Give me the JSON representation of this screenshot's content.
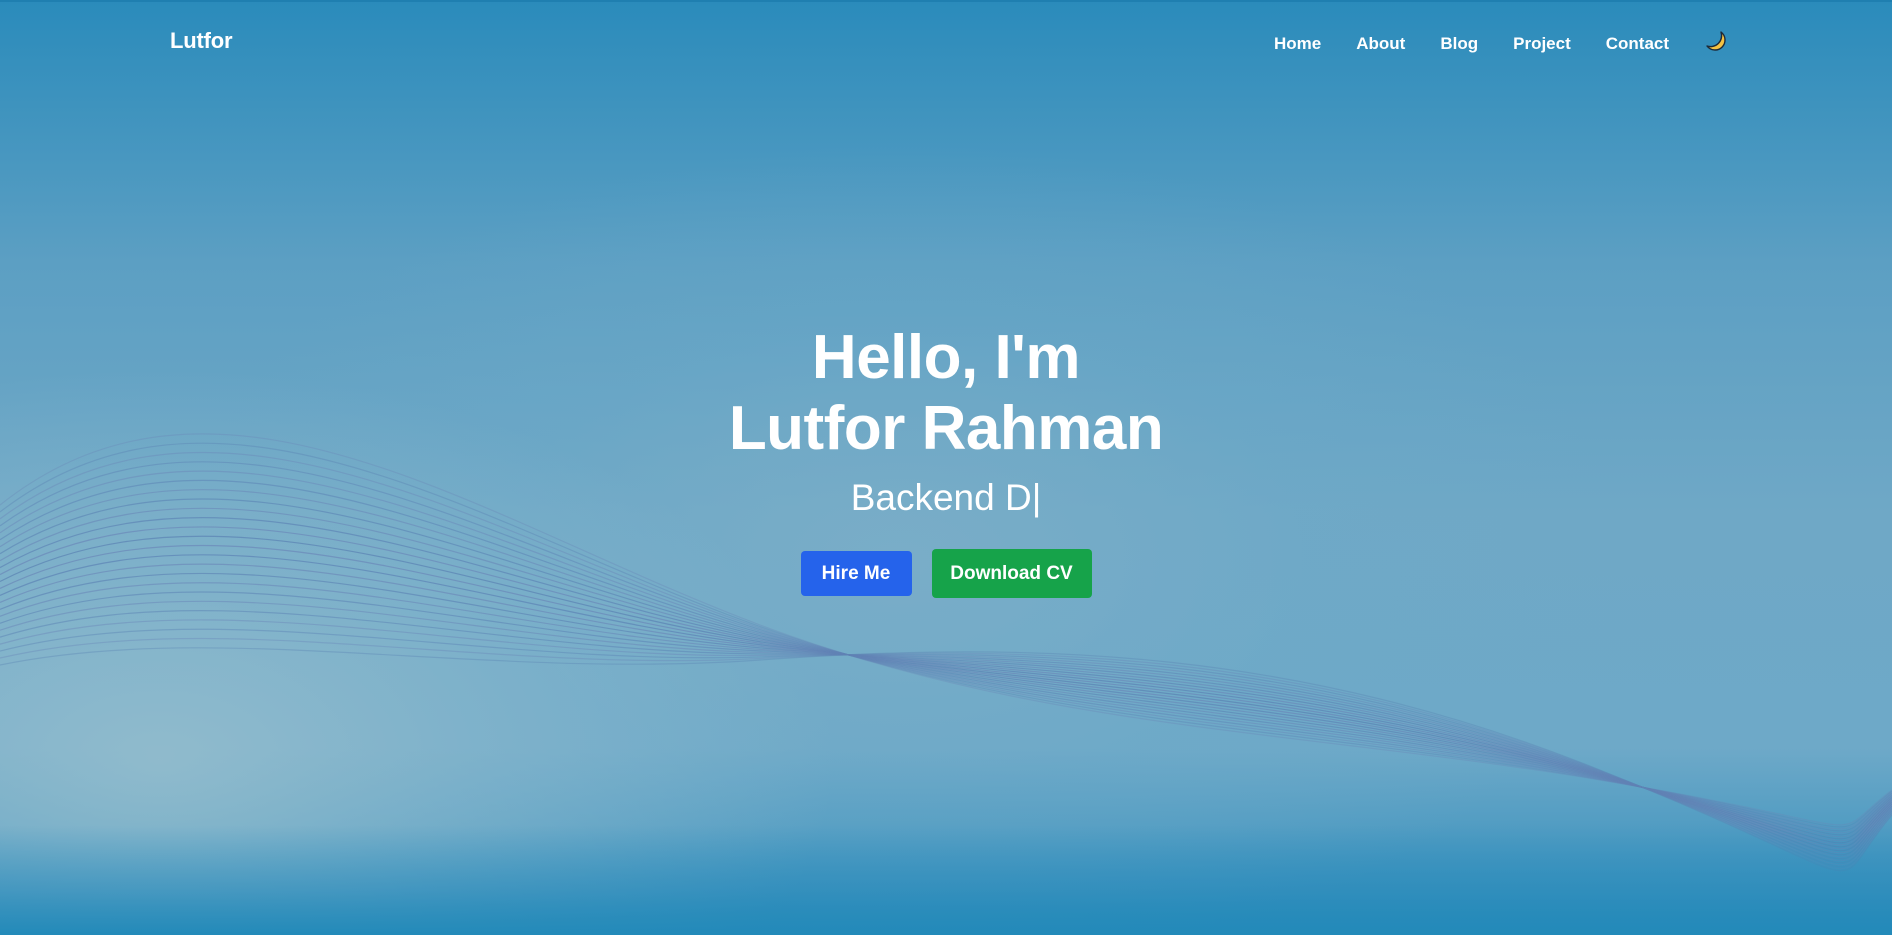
{
  "brand": "Lutfor",
  "nav": {
    "items": [
      "Home",
      "About",
      "Blog",
      "Project",
      "Contact"
    ],
    "theme_toggle_icon": "moon-icon"
  },
  "hero": {
    "greeting": "Hello, I'm",
    "name": "Lutfor Rahman",
    "role_typed": "Backend D",
    "cursor": "|",
    "hire_button": "Hire Me",
    "cv_button": "Download CV"
  },
  "colors": {
    "background": "#2589b9",
    "hire_button": "#2563eb",
    "cv_button": "#16a34a",
    "moon": "#f5c242"
  }
}
